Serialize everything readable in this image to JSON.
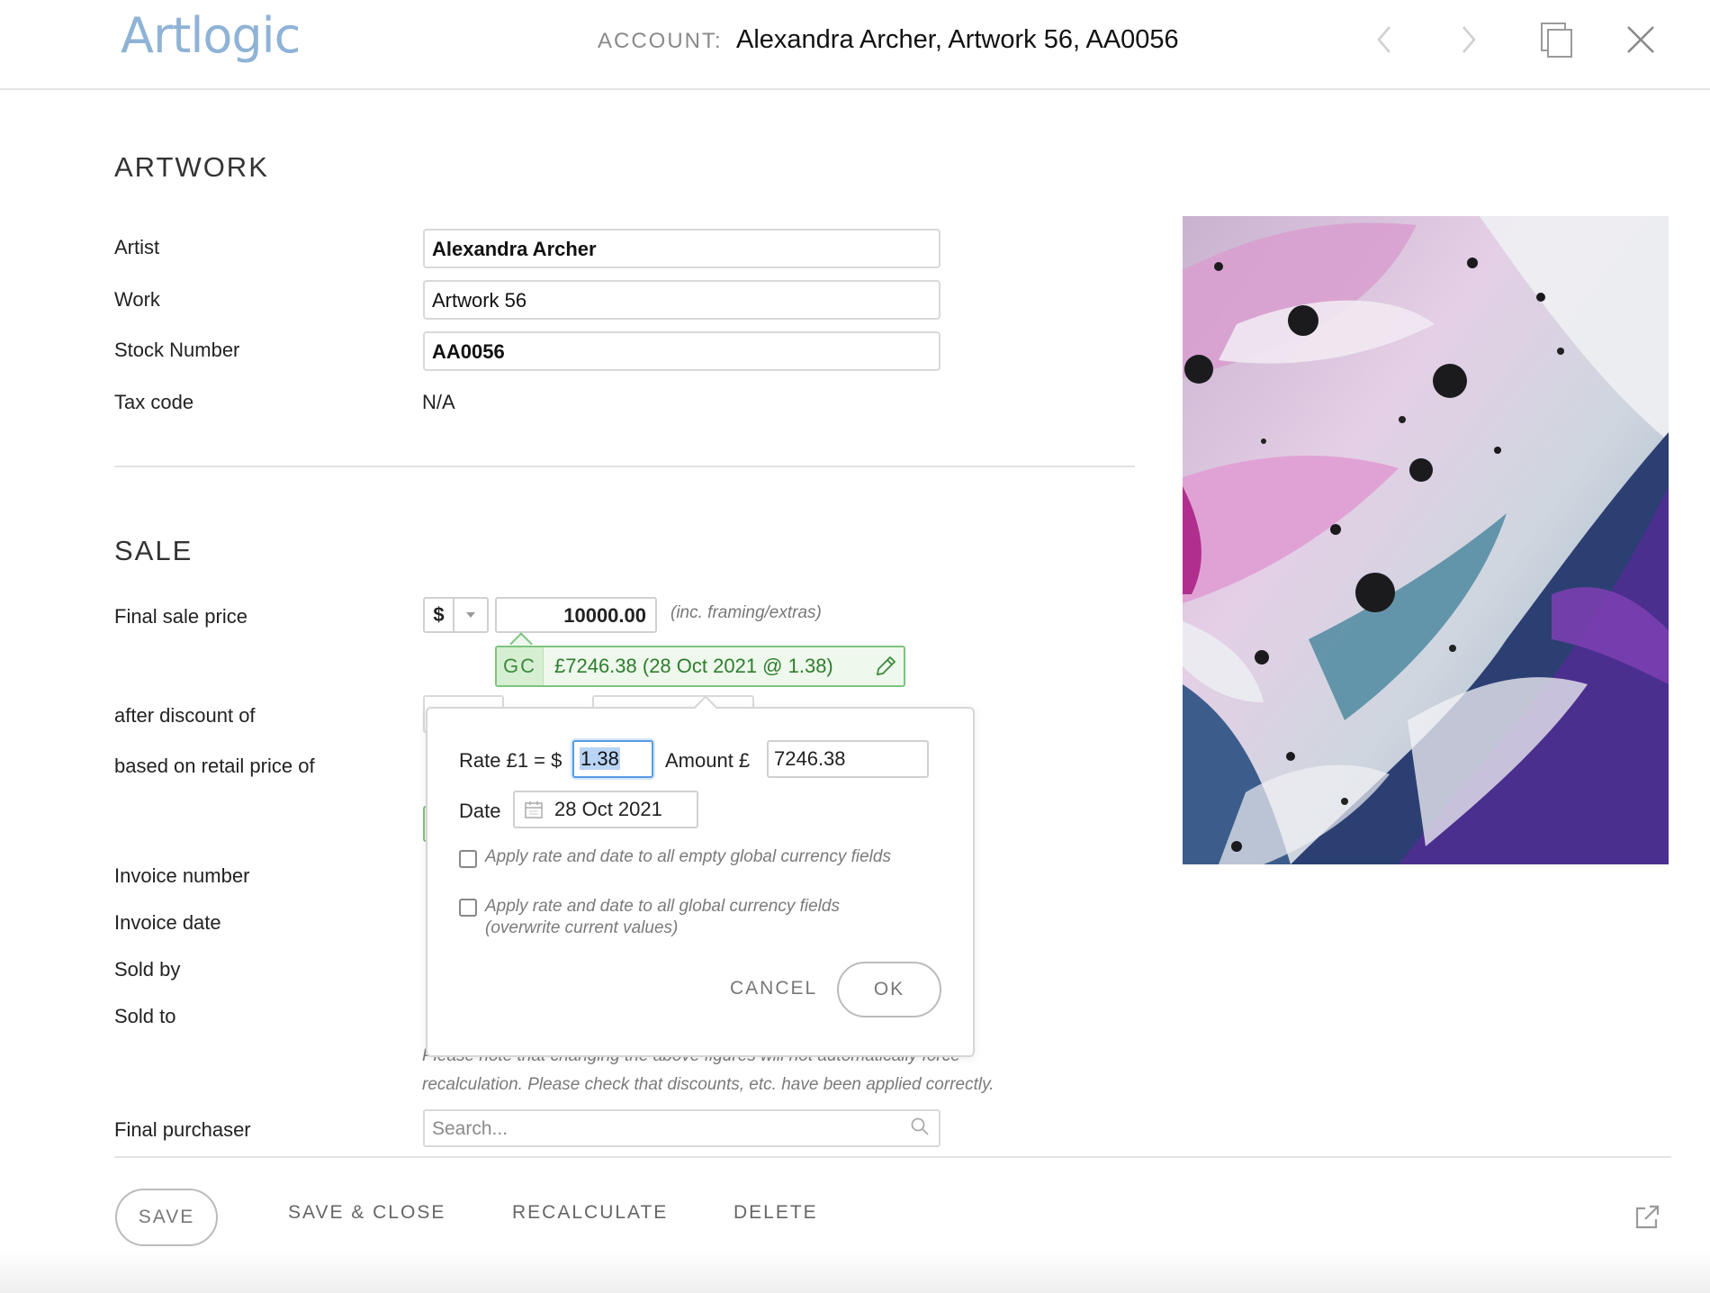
{
  "header": {
    "logo": "Artlogic",
    "account_label": "ACCOUNT:",
    "account_value": "Alexandra Archer, Artwork 56, AA0056",
    "icons": [
      "chevron-left-icon",
      "chevron-right-icon",
      "copy-icon",
      "close-icon"
    ]
  },
  "artwork": {
    "section_title": "ARTWORK",
    "artist_label": "Artist",
    "artist_value": "Alexandra Archer",
    "work_label": "Work",
    "work_value": "Artwork 56",
    "stock_label": "Stock Number",
    "stock_value": "AA0056",
    "tax_label": "Tax code",
    "tax_value": "N/A"
  },
  "sale": {
    "section_title": "SALE",
    "final_price_label": "Final sale price",
    "currency_symbol": "$",
    "price_value": "10000.00",
    "price_hint": "(inc. framing/extras)",
    "gc_tag": "GC",
    "gc_text": "£7246.38  (28 Oct 2021 @ 1.38)",
    "discount_label": "after discount of",
    "retail_label": "based on retail price of",
    "invoice_number_label": "Invoice number",
    "invoice_date_label": "Invoice date",
    "sold_by_label": "Sold by",
    "sold_to_label": "Sold to",
    "note_line1": "Please note that changing the above figures will not automatically force",
    "note_line2": "recalculation. Please check that discounts, etc. have been applied correctly.",
    "purchaser_label": "Final purchaser",
    "purchaser_placeholder": "Search..."
  },
  "popover": {
    "rate_label": "Rate £1 = $",
    "rate_value": "1.38",
    "amount_label": "Amount £",
    "amount_value": "7246.38",
    "date_label": "Date",
    "date_value": "28 Oct 2021",
    "check1": "Apply rate and date to all empty global currency fields",
    "check1_checked": false,
    "check2": "Apply rate and date to all global currency fields (overwrite current values)",
    "check2_checked": false,
    "cancel_label": "CANCEL",
    "ok_label": "OK"
  },
  "footer": {
    "save_label": "SAVE",
    "save_close_label": "SAVE & CLOSE",
    "recalculate_label": "RECALCULATE",
    "delete_label": "DELETE",
    "external_icon": "external-link-icon"
  },
  "colors": {
    "logo": "#8fb3d6",
    "gc_green": "#2f7d2f",
    "gc_border": "#7ec47e",
    "focus_blue": "#5a9be6"
  }
}
